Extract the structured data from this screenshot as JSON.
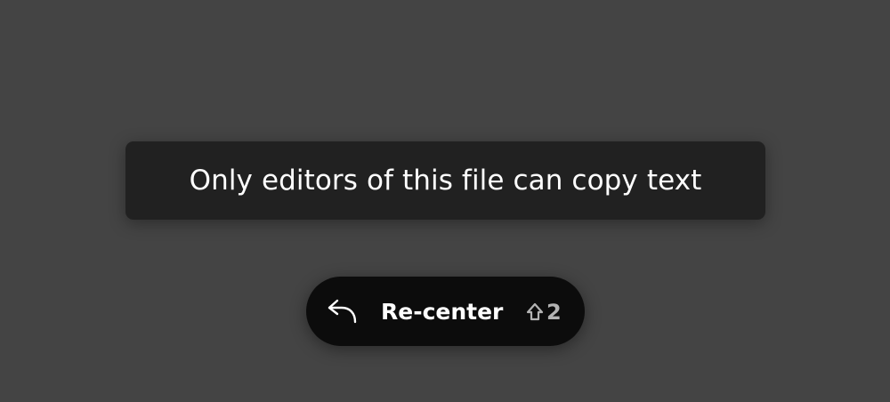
{
  "toast": {
    "message": "Only editors of this file can copy text"
  },
  "recenter": {
    "icon": "return-arrow-icon",
    "label": "Re-center",
    "shortcut_icon": "shift-icon",
    "shortcut_key": "2"
  },
  "colors": {
    "background": "#444444",
    "toast_bg": "#212121",
    "button_bg": "#0c0c0c",
    "text": "#ffffff",
    "shortcut_text": "#b3b3b3"
  }
}
